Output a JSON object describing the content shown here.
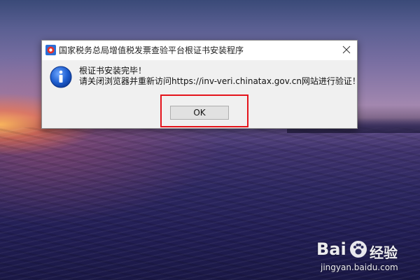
{
  "dialog": {
    "title": "国家税务总局增值税发票查验平台根证书安装程序",
    "icon": "info-icon",
    "message_line1": "根证书安装完毕！",
    "message_line2": "请关闭浏览器并重新访问https://inv-veri.chinatax.gov.cn网站进行验证！",
    "ok_label": "OK"
  },
  "annotation": {
    "highlight_color": "#e4141b"
  },
  "watermark": {
    "logo_text": "Bai",
    "jingyan_text": "经验",
    "url": "jingyan.baidu.com"
  }
}
